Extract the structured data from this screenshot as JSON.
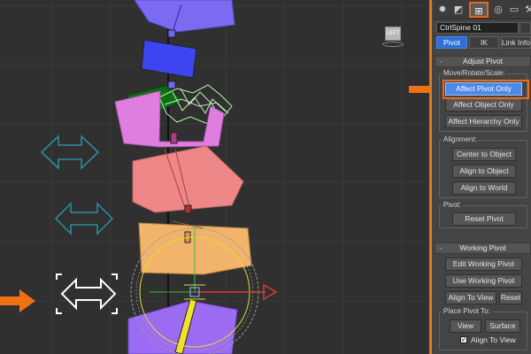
{
  "viewport": {
    "viewcube_label": "LEFT"
  },
  "panel": {
    "top_tabs": [
      "create-tab",
      "modify-tab",
      "hierarchy-tab",
      "motion-tab",
      "display-tab",
      "utilities-tab"
    ],
    "name_field": "CtrlSpine 01",
    "sub_tabs": [
      "Pivot",
      "IK",
      "Link Info"
    ],
    "active_sub_tab": "Pivot",
    "adjust_pivot": {
      "title": "Adjust Pivot",
      "sign": "-",
      "move_group": "Move/Rotate/Scale:",
      "affect_pivot_only": "Affect Pivot Only",
      "affect_object_only": "Affect Object Only",
      "affect_hierarchy_only": "Affect Hierarchy Only",
      "alignment_group": "Alignment:",
      "center_to_object": "Center to Object",
      "align_to_object": "Align to Object",
      "align_to_world": "Align to World",
      "pivot_group": "Pivot:",
      "reset_pivot": "Reset Pivot"
    },
    "working_pivot": {
      "title": "Working Pivot",
      "sign": "-",
      "edit_working_pivot": "Edit Working Pivot",
      "use_working_pivot": "Use Working Pivot",
      "align_to_view": "Align To View",
      "reset": "Reset",
      "place_group": "Place Pivot To:",
      "view": "View",
      "surface": "Surface",
      "align_to_view_check": "Align To View",
      "align_to_view_checked": true
    }
  },
  "colors": {
    "accent": "#ee6a14",
    "active_button": "#4d8ae8",
    "panel_bg": "#444444",
    "viewport_bg": "#303030"
  }
}
